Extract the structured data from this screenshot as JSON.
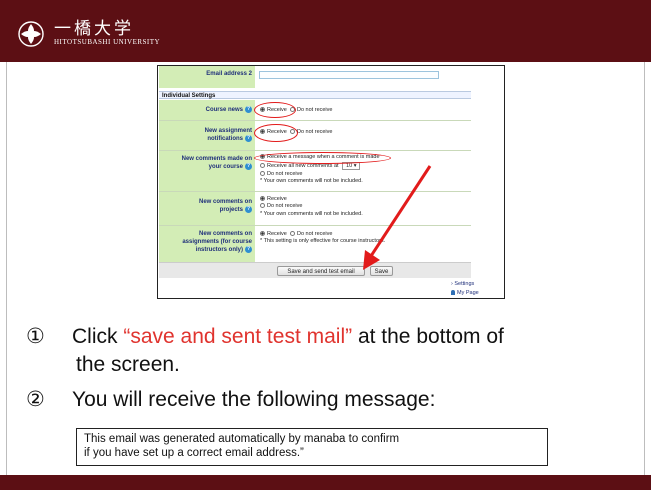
{
  "header": {
    "logo_jp": "一橋大学",
    "logo_en": "HITOTSUBASHI UNIVERSITY"
  },
  "form": {
    "email2_label": "Email address 2",
    "section_title": "Individual Settings",
    "course_news": {
      "label": "Course news",
      "opt_receive": "Receive",
      "opt_not": "Do not receive"
    },
    "assignment": {
      "label1": "New assignment",
      "label2": "notifications",
      "opt_receive": "Receive",
      "opt_not": "Do not receive"
    },
    "comments_course": {
      "label1": "New comments made on",
      "label2": "your course",
      "opt1": "Receive a message when a comment is made",
      "opt2": "Receive all new comments at",
      "select_value": "10",
      "opt3": "Do not receive",
      "note": "* Your own comments will not be included."
    },
    "comments_projects": {
      "label1": "New comments on",
      "label2": "projects",
      "opt_receive": "Receive",
      "opt_not": "Do not receive",
      "note": "* Your own comments will not be included."
    },
    "comments_assignments": {
      "label1": "New comments on",
      "label2": "assignments (for course",
      "label3": "instructors only)",
      "opt_receive": "Receive",
      "opt_not": "Do not receive",
      "note": "* This setting is only effective for course instructors."
    },
    "save_test_button": "Save and send test email",
    "save_button": "Save",
    "link_settings": "Settings",
    "link_mypage": "My Page",
    "help_mark": "?"
  },
  "instructions": {
    "step1_num": "①",
    "step1_pre": "Click ",
    "step1_highlight": "“save and sent test mail”",
    "step1_post": " at the bottom of",
    "step1_line2": "the screen.",
    "step2_num": "②",
    "step2_text": "You will receive the following message:"
  },
  "message_box": {
    "line1": "This email was generated automatically by manaba to confirm",
    "line2": "if you have set up a correct email address.”"
  },
  "colors": {
    "brand": "#5c0f14",
    "highlight_red": "#e0332e",
    "label_green": "#d3edb6"
  },
  "icons": {
    "logo": "university-seal-icon",
    "help": "help-icon",
    "arrow": "red-arrow-annotation"
  }
}
